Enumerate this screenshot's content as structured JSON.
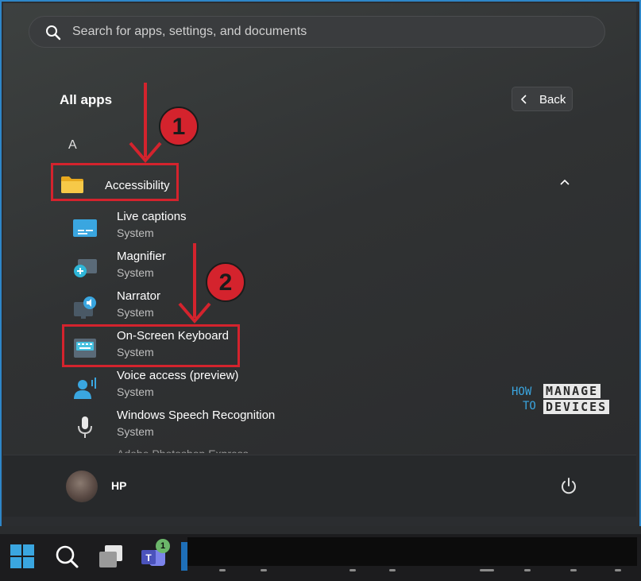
{
  "search": {
    "placeholder": "Search for apps, settings, and documents"
  },
  "header": {
    "title": "All apps",
    "back_label": "Back"
  },
  "section_letter": "A",
  "folder": {
    "label": "Accessibility"
  },
  "apps": [
    {
      "name": "Live captions",
      "sub": "System",
      "icon": "live-captions-icon"
    },
    {
      "name": "Magnifier",
      "sub": "System",
      "icon": "magnifier-icon"
    },
    {
      "name": "Narrator",
      "sub": "System",
      "icon": "narrator-icon"
    },
    {
      "name": "On-Screen Keyboard",
      "sub": "System",
      "icon": "on-screen-keyboard-icon"
    },
    {
      "name": "Voice access (preview)",
      "sub": "System",
      "icon": "voice-access-icon"
    },
    {
      "name": "Windows Speech Recognition",
      "sub": "System",
      "icon": "speech-recognition-icon"
    }
  ],
  "cutoff_text": "Adobe Photoshop Express",
  "user": {
    "name": "HP"
  },
  "annotations": {
    "step1": "1",
    "step2": "2",
    "color": "#d4232d"
  },
  "watermark": {
    "line1a": "HOW",
    "line1b": "MANAGE",
    "line2a": "TO",
    "line2b": "DEVICES"
  },
  "taskbar": {
    "teams_badge": "1"
  },
  "colors": {
    "accent": "#2e86c8",
    "annotation": "#d4232d",
    "folder": "#f4c542"
  }
}
